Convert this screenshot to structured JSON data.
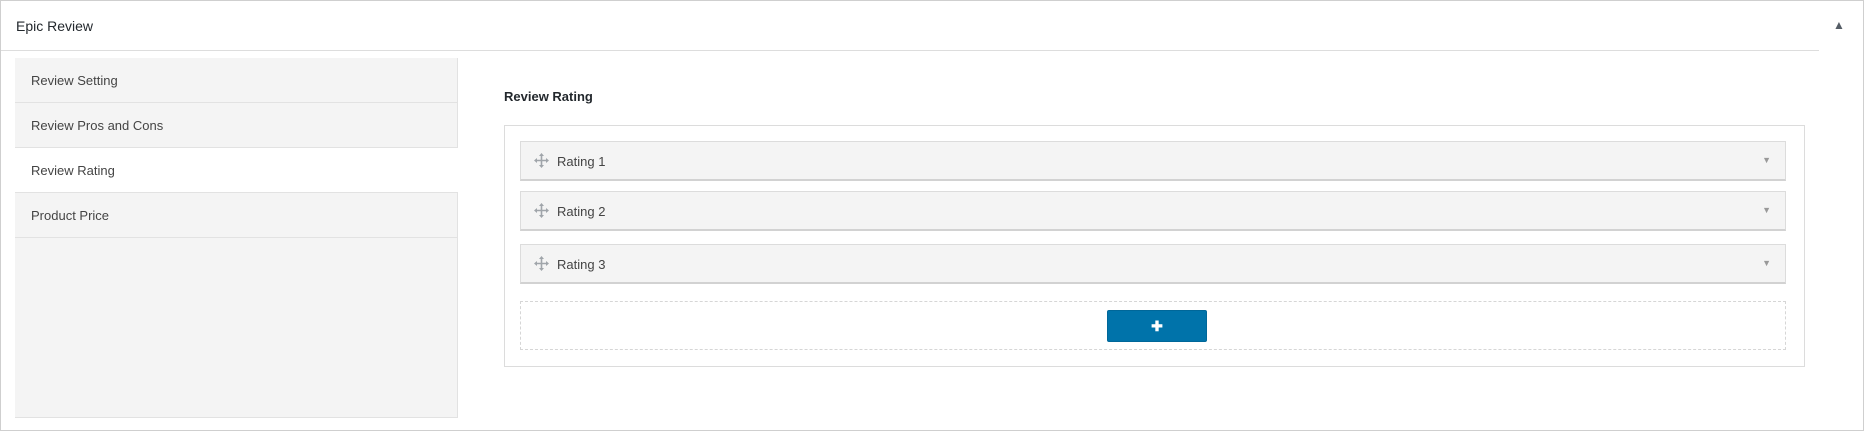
{
  "metabox": {
    "title": "Epic Review",
    "toggle_glyph": "▲"
  },
  "tabs": [
    {
      "label": "Review Setting",
      "active": false
    },
    {
      "label": "Review Pros and Cons",
      "active": false
    },
    {
      "label": "Review Rating",
      "active": true
    },
    {
      "label": "Product Price",
      "active": false
    }
  ],
  "section": {
    "title": "Review Rating"
  },
  "ratings": [
    {
      "label": "Rating 1"
    },
    {
      "label": "Rating 2"
    },
    {
      "label": "Rating 3"
    }
  ],
  "row_toggle_glyph": "▼",
  "add_button": {
    "label": "✚",
    "icon": "plus-icon"
  },
  "colors": {
    "accent": "#0073aa",
    "tab_bg": "#f4f4f4",
    "row_bg": "#f4f4f4",
    "border": "#dcdcdc"
  },
  "icons": {
    "drag": "move-arrows-icon",
    "toggle": "caret-up-icon",
    "row_toggle": "caret-down-icon"
  }
}
